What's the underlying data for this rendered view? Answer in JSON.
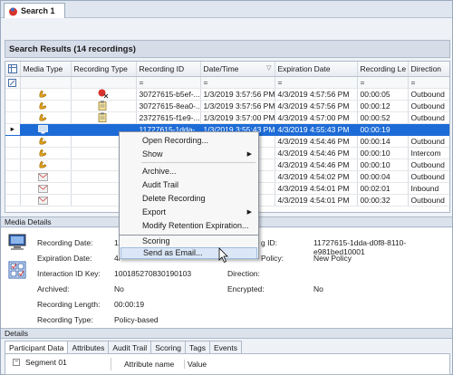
{
  "tab": {
    "label": "Search 1"
  },
  "results": {
    "title": "Search Results (14 recordings)"
  },
  "grid": {
    "columns": [
      "Media Type",
      "Recording Type",
      "Recording ID",
      "Date/Time",
      "Expiration Date",
      "Recording Le",
      "Direction"
    ],
    "rows": [
      {
        "id": "30727615-b5ef-...",
        "dt": "1/3/2019 3:57:56 PM",
        "exp": "4/3/2019 4:57:56 PM",
        "len": "00:00:05",
        "dir": "Outbound"
      },
      {
        "id": "30727615-8ea0-...",
        "dt": "1/3/2019 3:57:56 PM",
        "exp": "4/3/2019 4:57:56 PM",
        "len": "00:00:12",
        "dir": "Outbound"
      },
      {
        "id": "23727615-f1e9-...",
        "dt": "1/3/2019 3:57:00 PM",
        "exp": "4/3/2019 4:57:00 PM",
        "len": "00:00:52",
        "dir": "Outbound"
      },
      {
        "id": "11727615-1dda-...",
        "dt": "1/3/2019 3:55:43 PM",
        "exp": "4/3/2019 4:55:43 PM",
        "len": "00:00:19",
        "dir": ""
      },
      {
        "id": "",
        "dt": "",
        "exp": "4/3/2019 4:54:46 PM",
        "len": "00:00:14",
        "dir": "Outbound"
      },
      {
        "id": "",
        "dt": "",
        "exp": "4/3/2019 4:54:46 PM",
        "len": "00:00:10",
        "dir": "Intercom"
      },
      {
        "id": "",
        "dt": "",
        "exp": "4/3/2019 4:54:46 PM",
        "len": "00:00:10",
        "dir": "Outbound"
      },
      {
        "id": "",
        "dt": "",
        "exp": "4/3/2019 4:54:02 PM",
        "len": "00:00:04",
        "dir": "Outbound"
      },
      {
        "id": "",
        "dt": "",
        "exp": "4/3/2019 4:54:01 PM",
        "len": "00:02:01",
        "dir": "Inbound"
      },
      {
        "id": "",
        "dt": "",
        "exp": "4/3/2019 4:54:01 PM",
        "len": "00:00:32",
        "dir": "Outbound"
      }
    ]
  },
  "context_menu": {
    "items": [
      "Open Recording...",
      "Show",
      "Archive...",
      "Audit Trail",
      "Delete Recording",
      "Export",
      "Modify Retention Expiration...",
      "Scoring",
      "Send as Email..."
    ]
  },
  "media_details": {
    "title": "Media Details",
    "recording_date_label": "Recording Date:",
    "recording_date_value": "1/",
    "expiration_date_label": "Expiration Date:",
    "expiration_date_value": "4/",
    "interaction_id_label": "Interaction ID Key:",
    "interaction_id_value": "1001852708301901​03",
    "archived_label": "Archived:",
    "archived_value": "No",
    "recording_length_label": "Recording Length:",
    "recording_length_value": "00:00:19",
    "recording_type_label": "Recording Type:",
    "recording_type_value": "Policy-based",
    "recording_id_label": "g ID:",
    "recording_id_value": "11727615-1dda-d0f8-8110-e981bed10001",
    "policy_label": "Policy:",
    "policy_value": "New Policy",
    "direction_label": "Direction:",
    "encrypted_label": "Encrypted:",
    "encrypted_value": "No"
  },
  "details": {
    "title": "Details",
    "tabs": [
      "Participant Data",
      "Attributes",
      "Audit Trail",
      "Scoring",
      "Tags",
      "Events"
    ],
    "tree_item": "Segment 01",
    "attr_col1": "Attribute name",
    "attr_col2": "Value"
  }
}
